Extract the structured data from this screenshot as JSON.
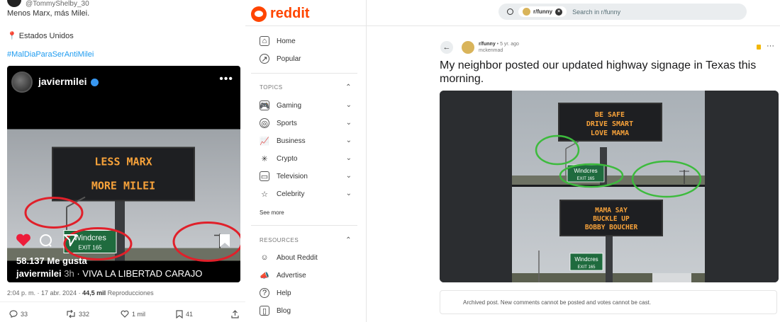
{
  "twitter": {
    "handle": "@TommyShelby_30",
    "text": "Menos Marx, más Milei.",
    "location": "Estados Unidos",
    "hashtag": "#MalDiaParaSerAntiMilei",
    "instagram": {
      "username": "javiermilei",
      "sign_lines": [
        "LESS MARX",
        "MORE MILEI"
      ],
      "green_sign": {
        "name": "Windcres",
        "exit": "EXIT  165"
      },
      "likes": "58.137 Me gusta",
      "caption_user": "javiermilei",
      "caption_time": "3h",
      "caption_text": "· VIVA LA LIBERTAD CARAJO"
    },
    "meta_time": "2:04 p. m. · 17 abr. 2024 · ",
    "meta_views": "44,5 mil",
    "meta_views_label": " Reproducciones",
    "stats": {
      "replies": "33",
      "reposts": "332",
      "likes": "1 mil",
      "bookmarks": "41"
    }
  },
  "reddit": {
    "logo_text": "reddit",
    "search": {
      "chip": "r/funny",
      "placeholder": "Search in r/funny"
    },
    "nav": [
      {
        "label": "Home",
        "icon": "home-icon"
      },
      {
        "label": "Popular",
        "icon": "popular-icon"
      }
    ],
    "topics_heading": "TOPICS",
    "topics": [
      {
        "label": "Gaming",
        "icon": "gaming-icon"
      },
      {
        "label": "Sports",
        "icon": "sports-icon"
      },
      {
        "label": "Business",
        "icon": "business-icon"
      },
      {
        "label": "Crypto",
        "icon": "crypto-icon"
      },
      {
        "label": "Television",
        "icon": "television-icon"
      },
      {
        "label": "Celebrity",
        "icon": "celebrity-icon"
      }
    ],
    "see_more": "See more",
    "resources_heading": "RESOURCES",
    "resources": [
      {
        "label": "About Reddit",
        "icon": "about-reddit-icon"
      },
      {
        "label": "Advertise",
        "icon": "advertise-icon"
      },
      {
        "label": "Help",
        "icon": "help-icon"
      },
      {
        "label": "Blog",
        "icon": "blog-icon"
      }
    ],
    "post": {
      "subreddit": "r/funny",
      "age": " • 5 yr. ago",
      "author": "mckenmad",
      "title": "My neighbor posted our updated highway signage in Texas this morning.",
      "sign_top": [
        "BE SAFE",
        "DRIVE SMART",
        "LOVE MAMA"
      ],
      "sign_bottom": [
        "MAMA SAY",
        "BUCKLE UP",
        "BOBBY BOUCHER"
      ],
      "green_sign": {
        "name": "Windcres",
        "exit": "EXIT 165"
      },
      "archived_note": "Archived post. New comments cannot be posted and votes cannot be cast."
    }
  },
  "colors": {
    "reddit_orange": "#ff4500",
    "sign_amber": "#f7a23a",
    "highway_green": "#1f6b3e",
    "annotation_red": "#e0202a",
    "annotation_green": "#3dbb3d"
  }
}
